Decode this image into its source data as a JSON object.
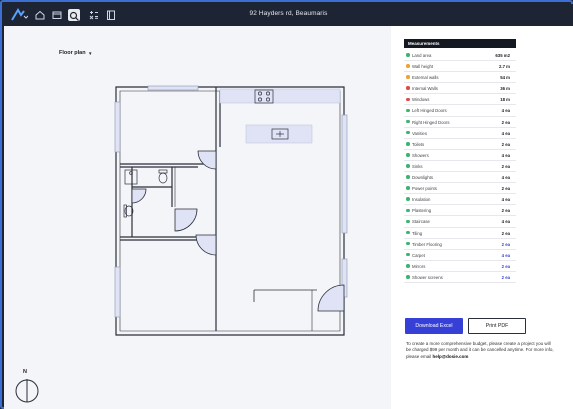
{
  "window": {
    "title": "92 Hayders rd, Beaumaris"
  },
  "toolbar": {
    "icons": [
      "logo-icon",
      "home-icon",
      "wallet-icon",
      "measure-tool-icon",
      "calculator-icon",
      "document-icon"
    ],
    "active": "measure-tool-icon"
  },
  "floor_selector": {
    "label": "Floor plan"
  },
  "compass": {
    "label": "N"
  },
  "measurements": {
    "header": "Measurements",
    "rows": [
      {
        "name": "Land area",
        "value": "635 m2",
        "color": "#3cb371",
        "value_color": "default"
      },
      {
        "name": "Wall height",
        "value": "2.7 m",
        "color": "#f0a030",
        "value_color": "default"
      },
      {
        "name": "External walls",
        "value": "54 m",
        "color": "#f0a030",
        "value_color": "default"
      },
      {
        "name": "Internal Walls",
        "value": "36 m",
        "color": "#e04848",
        "value_color": "default"
      },
      {
        "name": "Windows",
        "value": "18 m",
        "color": "#e04848",
        "value_color": "default"
      },
      {
        "name": "Left Hinged Doors",
        "value": "4 ea",
        "color": "#3cb371",
        "value_color": "default"
      },
      {
        "name": "Right Hinged Doors",
        "value": "2 ea",
        "color": "#3cb371",
        "value_color": "default"
      },
      {
        "name": "Vanities",
        "value": "4 ea",
        "color": "#3cb371",
        "value_color": "default"
      },
      {
        "name": "Toilets",
        "value": "2 ea",
        "color": "#3cb371",
        "value_color": "default"
      },
      {
        "name": "Showers",
        "value": "4 ea",
        "color": "#3cb371",
        "value_color": "default"
      },
      {
        "name": "Sinks",
        "value": "2 ea",
        "color": "#3cb371",
        "value_color": "default"
      },
      {
        "name": "Downlights",
        "value": "4 ea",
        "color": "#3cb371",
        "value_color": "default"
      },
      {
        "name": "Power points",
        "value": "2 ea",
        "color": "#3cb371",
        "value_color": "default"
      },
      {
        "name": "Insulation",
        "value": "4 ea",
        "color": "#3cb371",
        "value_color": "default"
      },
      {
        "name": "Plastering",
        "value": "2 ea",
        "color": "#3cb371",
        "value_color": "default"
      },
      {
        "name": "Staircase",
        "value": "4 ea",
        "color": "#3cb371",
        "value_color": "default"
      },
      {
        "name": "Tiling",
        "value": "2 ea",
        "color": "#3cb371",
        "value_color": "default"
      },
      {
        "name": "Timber Flooring",
        "value": "2 ea",
        "color": "#3cb371",
        "value_color": "blue"
      },
      {
        "name": "Carpet",
        "value": "4 ea",
        "color": "#3cb371",
        "value_color": "blue"
      },
      {
        "name": "Mirrors",
        "value": "2 ea",
        "color": "#3cb371",
        "value_color": "blue"
      },
      {
        "name": "Shower screens",
        "value": "2 ea",
        "color": "#3cb371",
        "value_color": "blue"
      }
    ]
  },
  "actions": {
    "download": "Download Excel",
    "print": "Print PDF"
  },
  "note": {
    "text": "To create a more comprehensive budget, please create a project you will be charged $99 per month and it can be cancelled anytime. For more info, please email",
    "email": "help@dosie.com"
  },
  "colors": {
    "accent": "#3640d6",
    "chrome": "#1d2433",
    "highlight": "#3b6fd4"
  }
}
